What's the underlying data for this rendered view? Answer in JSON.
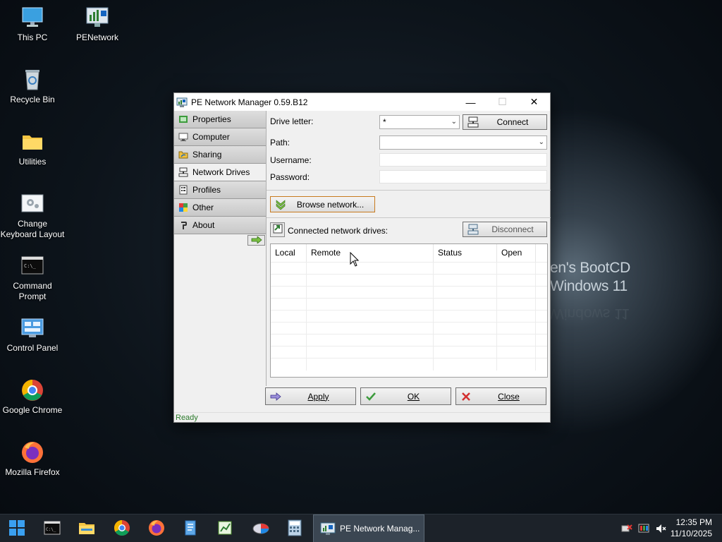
{
  "wallpaper": {
    "line1": "en's BootCD",
    "line2": "Windows 11"
  },
  "desktop": {
    "icons": [
      {
        "label": "This PC",
        "icon": "monitor-icon"
      },
      {
        "label": "PENetwork",
        "icon": "network-monitor-icon"
      },
      {
        "label": "Recycle Bin",
        "icon": "recycle-bin-icon"
      },
      {
        "label": "Utilities",
        "icon": "folder-icon"
      },
      {
        "label": "Change Keyboard Layout",
        "icon": "keyboard-settings-icon"
      },
      {
        "label": "Command Prompt",
        "icon": "console-icon"
      },
      {
        "label": "Control Panel",
        "icon": "control-panel-icon"
      },
      {
        "label": "Google Chrome",
        "icon": "chrome-icon"
      },
      {
        "label": "Mozilla Firefox",
        "icon": "firefox-icon"
      }
    ]
  },
  "window": {
    "title": "PE Network Manager 0.59.B12",
    "controls": {
      "minimize": "—",
      "maximize": "☐",
      "close": "✕"
    },
    "nav": [
      {
        "label": "Properties",
        "selected": false
      },
      {
        "label": "Computer",
        "selected": false
      },
      {
        "label": "Sharing",
        "selected": false
      },
      {
        "label": "Network Drives",
        "selected": true
      },
      {
        "label": "Profiles",
        "selected": false
      },
      {
        "label": "Other",
        "selected": false
      },
      {
        "label": "About",
        "selected": false
      }
    ],
    "form": {
      "drive_letter_label": "Drive letter:",
      "drive_letter_value": "*",
      "connect_label": "Connect",
      "path_label": "Path:",
      "path_value": "",
      "username_label": "Username:",
      "username_value": "",
      "password_label": "Password:",
      "password_value": "",
      "browse_label": "Browse network..."
    },
    "drives": {
      "header_label": "Connected network drives:",
      "disconnect_label": "Disconnect",
      "columns": [
        "Local",
        "Remote",
        "Status",
        "Open"
      ],
      "rows": []
    },
    "buttons": {
      "apply": "Apply",
      "ok": "OK",
      "close": "Close"
    },
    "status": "Ready"
  },
  "taskbar": {
    "active_app_label": "PE Network Manag...",
    "time": "12:35 PM",
    "date": "11/10/2025"
  },
  "colors": {
    "status_text": "#2b7a2b",
    "taskbar": "#1c2229",
    "selected_nav": "#f0f0f0"
  }
}
